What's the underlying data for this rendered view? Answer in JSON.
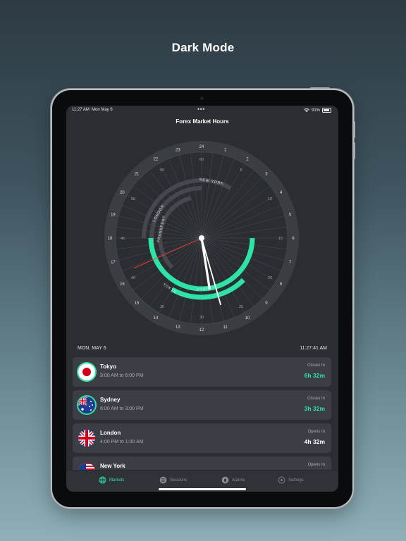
{
  "promo": {
    "title": "Dark Mode"
  },
  "status_bar": {
    "time": "11:27 AM",
    "date": "Mon May 6",
    "battery": "91%"
  },
  "nav": {
    "title": "Forex Market Hours"
  },
  "clock": {
    "hour_labels": [
      "24",
      "1",
      "2",
      "3",
      "4",
      "5",
      "6",
      "7",
      "8",
      "9",
      "10",
      "11",
      "12",
      "13",
      "14",
      "15",
      "16",
      "17",
      "18",
      "19",
      "20",
      "21",
      "22",
      "23"
    ],
    "minute_labels": [
      "60",
      "5",
      "10",
      "15",
      "20",
      "25",
      "30",
      "35",
      "40",
      "45",
      "50",
      "55"
    ],
    "sessions": [
      {
        "name": "NEW YORK",
        "open": false
      },
      {
        "name": "LONDON",
        "open": false
      },
      {
        "name": "FRANKFURT",
        "open": false
      },
      {
        "name": "SYDNEY",
        "open": true
      },
      {
        "name": "TOKYO",
        "open": true
      }
    ],
    "accent_color": "#2fe3a6",
    "second_hand_color": "#ff3b30"
  },
  "date_bar": {
    "date": "MON, MAY 6",
    "time": "11:27:41 AM"
  },
  "markets": [
    {
      "name": "Tokyo",
      "hours": "9:00 AM to 6:00 PM",
      "status": "Closes In",
      "duration": "6h 32m",
      "open": true,
      "flag_icon": "japan-flag-icon"
    },
    {
      "name": "Sydney",
      "hours": "6:00 AM to 3:00 PM",
      "status": "Closes In",
      "duration": "3h 32m",
      "open": true,
      "flag_icon": "australia-flag-icon"
    },
    {
      "name": "London",
      "hours": "4:00 PM to 1:00 AM",
      "status": "Opens In",
      "duration": "4h 32m",
      "open": false,
      "flag_icon": "uk-flag-icon"
    },
    {
      "name": "New York",
      "hours": "",
      "status": "Opens In",
      "duration": "",
      "open": false,
      "flag_icon": "us-flag-icon"
    }
  ],
  "tabs": [
    {
      "label": "Markets",
      "icon": "globe-icon",
      "active": true
    },
    {
      "label": "Sessions",
      "icon": "list-icon",
      "active": false
    },
    {
      "label": "Alarms",
      "icon": "bell-icon",
      "active": false
    },
    {
      "label": "Settings",
      "icon": "settings-icon",
      "active": false
    }
  ]
}
